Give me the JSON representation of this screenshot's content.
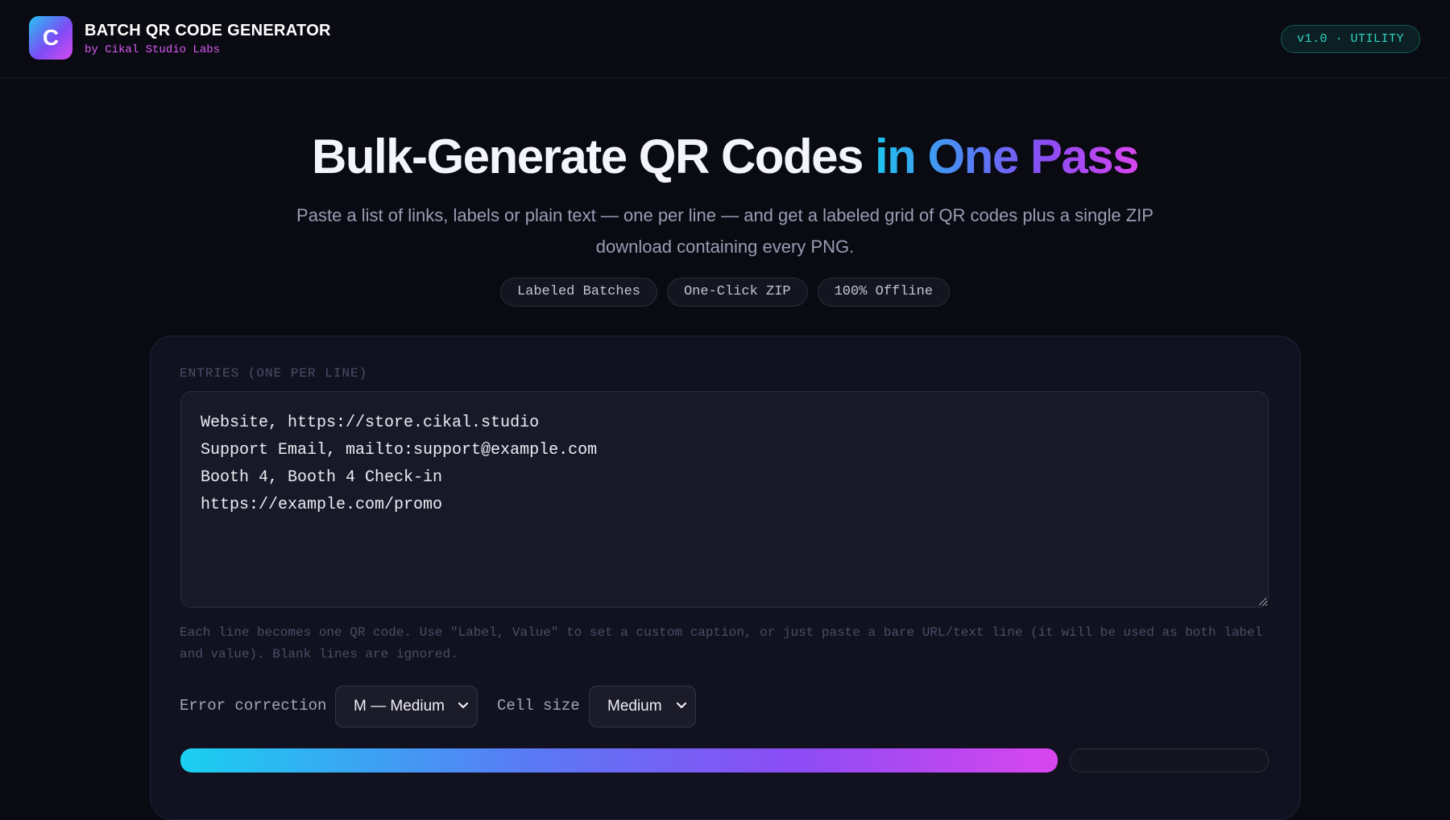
{
  "header": {
    "logo_letter": "C",
    "title": "BATCH QR CODE GENERATOR",
    "subtitle": "by Cikal Studio Labs",
    "version": "v1.0 · UTILITY"
  },
  "hero": {
    "title_plain": "Bulk-Generate QR Codes ",
    "title_accent": "in One Pass",
    "subtitle": "Paste a list of links, labels or plain text — one per line — and get a labeled grid of QR codes plus a single ZIP download containing every PNG.",
    "pills": [
      "Labeled Batches",
      "One-Click ZIP",
      "100% Offline"
    ]
  },
  "form": {
    "entries_label": "ENTRIES (ONE PER LINE)",
    "entries_value": "Website, https://store.cikal.studio\nSupport Email, mailto:support@example.com\nBooth 4, Booth 4 Check-in\nhttps://example.com/promo",
    "hint": "Each line becomes one QR code. Use \"Label, Value\" to set a custom caption, or just paste a bare URL/text line (it will be used as both label and value). Blank lines are ignored.",
    "error_correction_label": "Error correction",
    "error_correction_value": "M — Medium",
    "cell_size_label": "Cell size",
    "cell_size_value": "Medium"
  },
  "colors": {
    "accent_cyan": "#1fc4ee",
    "accent_violet": "#8a4cf4",
    "accent_magenta": "#d946ef",
    "version_teal": "#2fd6c4"
  }
}
